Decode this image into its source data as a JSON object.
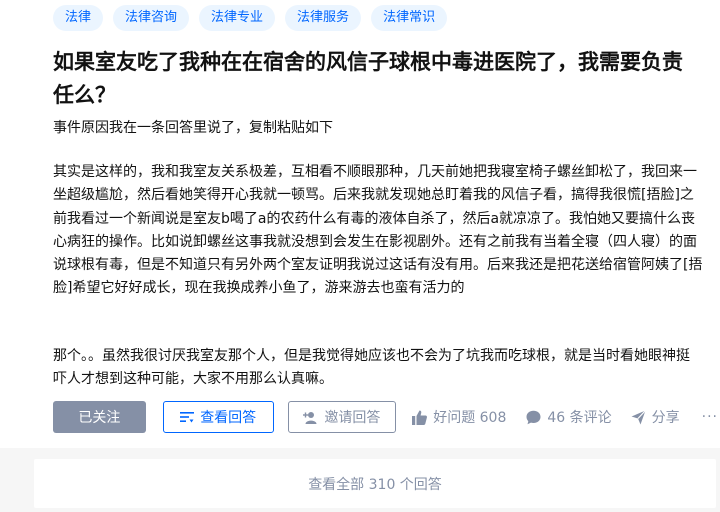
{
  "tags": [
    "法律",
    "法律咨询",
    "法律专业",
    "法律服务",
    "法律常识"
  ],
  "question": {
    "title": "如果室友吃了我种在在宿舍的风信子球根中毒进医院了，我需要负责任么？",
    "lead": "事件原因我在一条回答里说了，复制粘贴如下",
    "paragraphs": [
      "其实是这样的，我和我室友关系极差，互相看不顺眼那种，几天前她把我寝室椅子螺丝卸松了，我回来一坐超级尴尬，然后看她笑得开心我就一顿骂。后来我就发现她总盯着我的风信子看，搞得我很慌[捂脸]之前我看过一个新闻说是室友b喝了a的农药什么有毒的液体自杀了，然后a就凉凉了。我怕她又要搞什么丧心病狂的操作。比如说卸螺丝这事我就没想到会发生在影视剧外。还有之前我有当着全寝（四人寝）的面说球根有毒，但是不知道只有另外两个室友证明我说过这话有没有用。后来我还是把花送给宿管阿姨了[捂脸]希望它好好成长，现在我换成养小鱼了，游来游去也蛮有活力的",
      "那个。。虽然我很讨厌我室友那个人，但是我觉得她应该也不会为了坑我而吃球根，就是当时看她眼神挺吓人才想到这种可能，大家不用那么认真嘛。"
    ]
  },
  "actions": {
    "follow_label": "已关注",
    "view_answers_label": "查看回答",
    "invite_label": "邀请回答",
    "upvote_label": "好问题 608",
    "comments_label": "46 条评论",
    "share_label": "分享",
    "more_label": "···"
  },
  "footer": {
    "view_all_label": "查看全部 310 个回答"
  },
  "colors": {
    "accent": "#0066ff",
    "muted": "#8590a6",
    "tag_bg": "#ebf5ff"
  }
}
